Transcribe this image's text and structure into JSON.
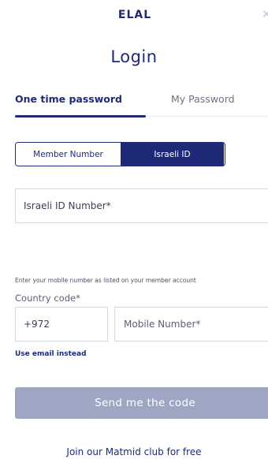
{
  "header": {
    "logo_text": "ELAL",
    "close_glyph": "×",
    "logo_icon": "elal-logo",
    "close_icon": "close-icon"
  },
  "login": {
    "title": "Login",
    "tabs": [
      {
        "label": "One time password",
        "active": true
      },
      {
        "label": "My Password",
        "active": false
      }
    ],
    "segmented": [
      {
        "label": "Member Number",
        "selected": false
      },
      {
        "label": "Israeli ID",
        "selected": true
      }
    ],
    "id_field_placeholder": "Israeli ID Number*",
    "mobile_hint": "Enter your mobile number as listed on your member account",
    "country_code_label": "Country code*",
    "country_code_value": "+972",
    "mobile_placeholder": "Mobile Number*",
    "use_email_link": "Use email instead",
    "send_button": "Send me the code",
    "join_link": "Join our Matmid club for free"
  },
  "colors": {
    "brand": "#1e2a78",
    "button_disabled": "#9fa6c4",
    "border": "#d6d8e2"
  }
}
